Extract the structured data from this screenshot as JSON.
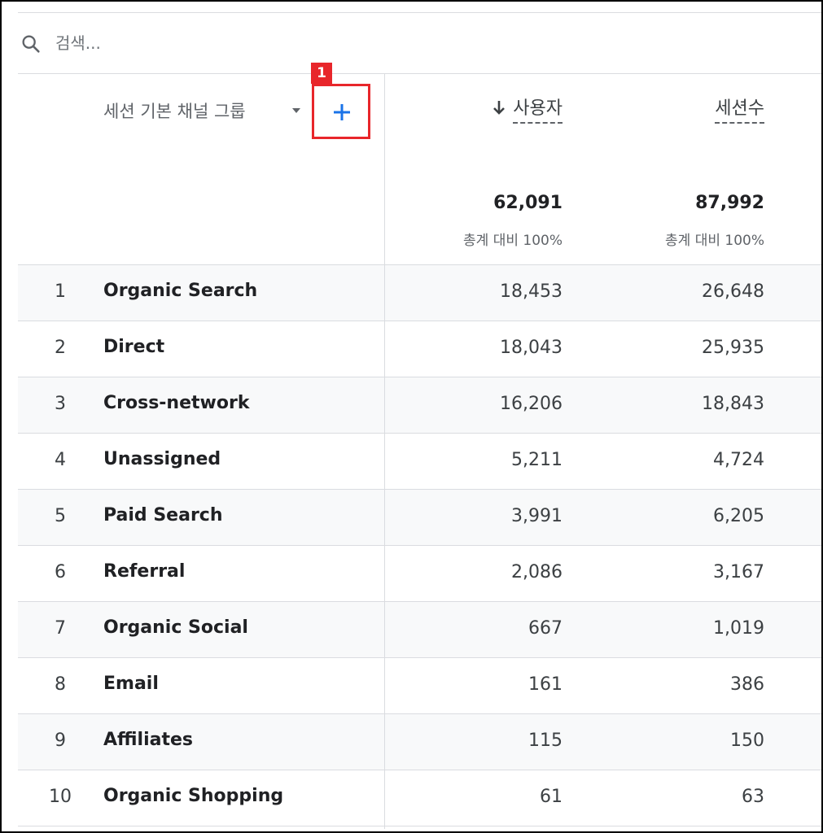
{
  "search": {
    "placeholder": "검색..."
  },
  "header": {
    "dimension_label": "세션 기본 채널 그룹",
    "annotation_badge": "1",
    "metrics": [
      {
        "label": "사용자",
        "total": "62,091",
        "total_pct": "총계 대비 100%",
        "sorted": true
      },
      {
        "label": "세션수",
        "total": "87,992",
        "total_pct": "총계 대비 100%",
        "sorted": false
      }
    ]
  },
  "colors": {
    "accent_blue": "#1a73e8",
    "annotation_red": "#e8262b",
    "divider": "#dadce0",
    "row_alt": "#f8f9fa"
  },
  "icons": {
    "search": "search-icon",
    "dropdown": "caret-down-icon",
    "add": "plus-icon",
    "sort": "arrow-down-icon"
  },
  "rows": [
    {
      "index": "1",
      "name": "Organic Search",
      "users": "18,453",
      "sessions": "26,648"
    },
    {
      "index": "2",
      "name": "Direct",
      "users": "18,043",
      "sessions": "25,935"
    },
    {
      "index": "3",
      "name": "Cross-network",
      "users": "16,206",
      "sessions": "18,843"
    },
    {
      "index": "4",
      "name": "Unassigned",
      "users": "5,211",
      "sessions": "4,724"
    },
    {
      "index": "5",
      "name": "Paid Search",
      "users": "3,991",
      "sessions": "6,205"
    },
    {
      "index": "6",
      "name": "Referral",
      "users": "2,086",
      "sessions": "3,167"
    },
    {
      "index": "7",
      "name": "Organic Social",
      "users": "667",
      "sessions": "1,019"
    },
    {
      "index": "8",
      "name": "Email",
      "users": "161",
      "sessions": "386"
    },
    {
      "index": "9",
      "name": "Affiliates",
      "users": "115",
      "sessions": "150"
    },
    {
      "index": "10",
      "name": "Organic Shopping",
      "users": "61",
      "sessions": "63"
    }
  ]
}
